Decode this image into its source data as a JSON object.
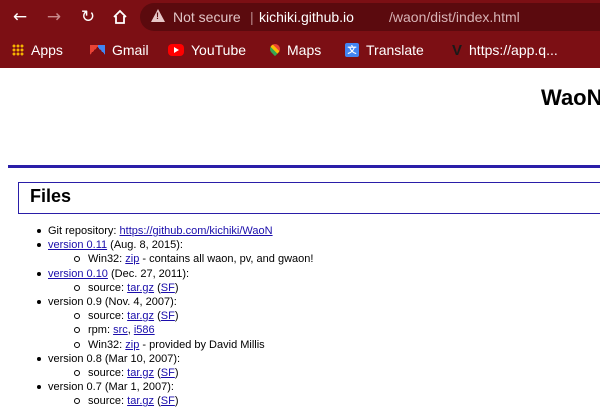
{
  "browser": {
    "security_label": "Not secure",
    "separator": "|",
    "url_host": "kichiki.github.io",
    "url_path": "/waon/dist/index.html",
    "colors": {
      "chrome": "#7c0f14",
      "omnibox": "#5b0a0e"
    },
    "bookmarks": [
      {
        "label": "Apps",
        "icon": "apps-grid-icon"
      },
      {
        "label": "Gmail",
        "icon": "gmail-icon"
      },
      {
        "label": "YouTube",
        "icon": "youtube-icon"
      },
      {
        "label": "Maps",
        "icon": "maps-icon"
      },
      {
        "label": "Translate",
        "icon": "translate-icon"
      },
      {
        "label": "https://app.q...",
        "icon": "v-icon"
      }
    ]
  },
  "page": {
    "title": "WaoN",
    "section_heading": "Files",
    "git": {
      "label": "Git repository: ",
      "link": "https://github.com/kichiki/WaoN"
    },
    "releases": [
      {
        "version": "version 0.11",
        "linked": true,
        "date": " (Aug. 8, 2015):",
        "items": [
          {
            "prefix": "Win32: ",
            "links": [
              "zip"
            ],
            "suffix": " - contains all waon, pv, and gwaon!"
          }
        ]
      },
      {
        "version": "version 0.10",
        "linked": true,
        "date": " (Dec. 27, 2011):",
        "items": [
          {
            "prefix": "source: ",
            "links": [
              "tar.gz",
              "SF"
            ],
            "suffix": ")"
          }
        ]
      },
      {
        "version": "version 0.9",
        "linked": false,
        "date": " (Nov. 4, 2007):",
        "items": [
          {
            "prefix": "source: ",
            "links": [
              "tar.gz",
              "SF"
            ],
            "suffix": ")"
          },
          {
            "prefix": "rpm: ",
            "links": [
              "src",
              "i586"
            ],
            "suffix": ""
          },
          {
            "prefix": "Win32: ",
            "links": [
              "zip"
            ],
            "suffix": " - provided by David Millis"
          }
        ]
      },
      {
        "version": "version 0.8",
        "linked": false,
        "date": " (Mar 10, 2007):",
        "items": [
          {
            "prefix": "source: ",
            "links": [
              "tar.gz",
              "SF"
            ],
            "suffix": ")"
          }
        ]
      },
      {
        "version": "version 0.7",
        "linked": false,
        "date": " (Mar 1, 2007):",
        "items": [
          {
            "prefix": "source: ",
            "links": [
              "tar.gz",
              "SF"
            ],
            "suffix": ")"
          }
        ]
      }
    ]
  }
}
